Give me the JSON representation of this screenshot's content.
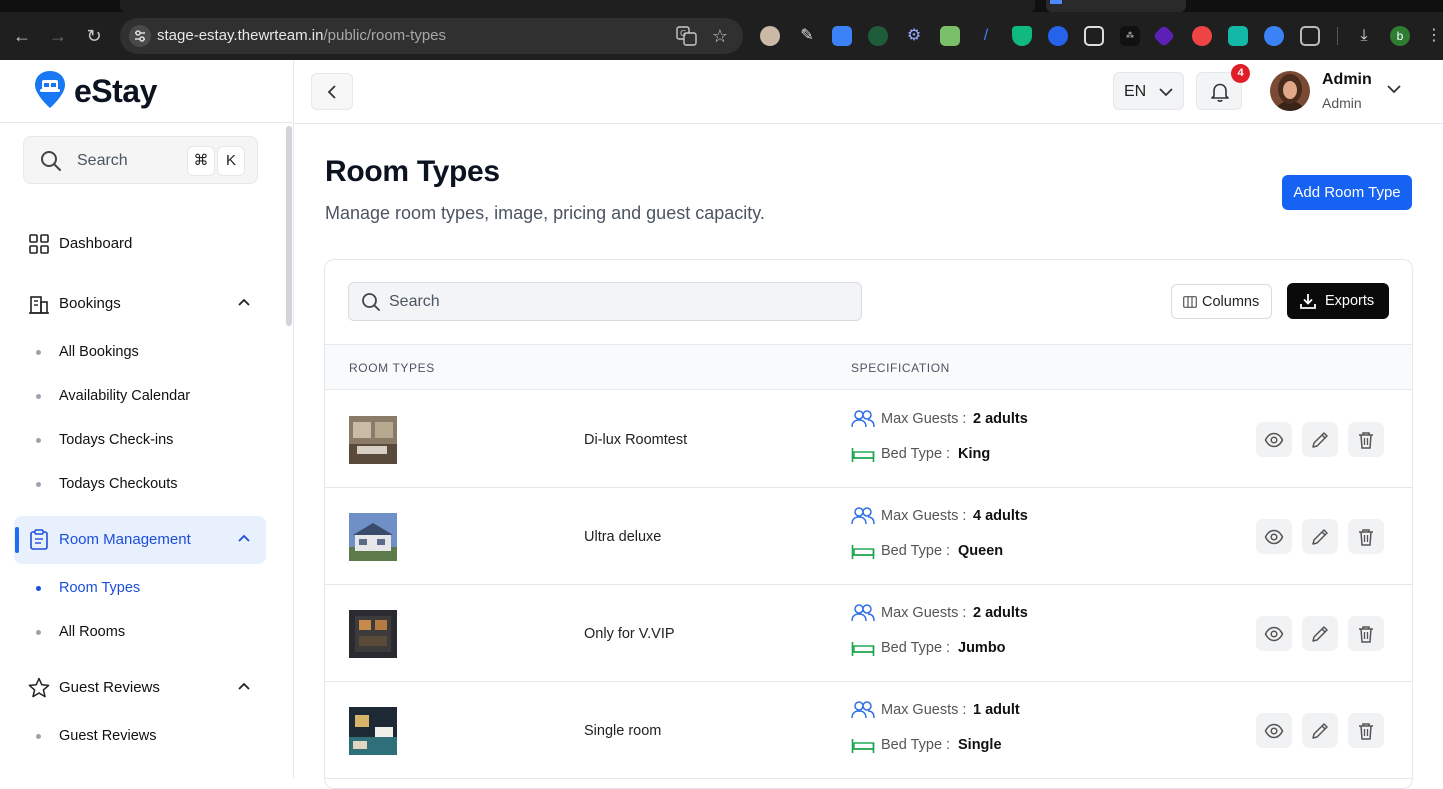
{
  "browser": {
    "url_host": "stage-estay.thewrteam.in",
    "url_path": "/public/room-types",
    "profile_initial": "b"
  },
  "sidebar": {
    "brand": "eStay",
    "search": {
      "label": "Search",
      "shortcut_mod": "⌘",
      "shortcut_key": "K"
    },
    "nav": {
      "dashboard": "Dashboard",
      "bookings": "Bookings",
      "bookings_items": [
        "All Bookings",
        "Availability Calendar",
        "Todays Check-ins",
        "Todays Checkouts"
      ],
      "room_management": "Room Management",
      "room_items": [
        "Room Types",
        "All Rooms"
      ],
      "guest_reviews": "Guest Reviews",
      "guest_items": [
        "Guest Reviews"
      ]
    }
  },
  "topbar": {
    "language": "EN",
    "notification_count": "4",
    "user_name": "Admin",
    "user_role": "Admin"
  },
  "page": {
    "title": "Room Types",
    "subtitle": "Manage room types, image, pricing and guest capacity.",
    "add_button": "Add Room Type"
  },
  "table": {
    "search_placeholder": "Search",
    "columns_button": "Columns",
    "exports_button": "Exports",
    "headers": {
      "room_types": "ROOM TYPES",
      "specification": "SPECIFICATION"
    },
    "max_guests_label": "Max Guests :",
    "bed_type_label": "Bed Type :",
    "rows": [
      {
        "name": "Di-lux Roomtest",
        "max_guests": "2 adults",
        "bed_type": "King"
      },
      {
        "name": "Ultra deluxe",
        "max_guests": "4 adults",
        "bed_type": "Queen"
      },
      {
        "name": "Only for V.VIP",
        "max_guests": "2 adults",
        "bed_type": "Jumbo"
      },
      {
        "name": "Single room",
        "max_guests": "1 adult",
        "bed_type": "Single"
      }
    ]
  },
  "colors": {
    "accent": "#1662f2",
    "active_bg": "#e8f0fe",
    "active_text": "#1d4ed8",
    "spec_icon_blue": "#2f6fe6",
    "spec_icon_green": "#17a34a"
  }
}
